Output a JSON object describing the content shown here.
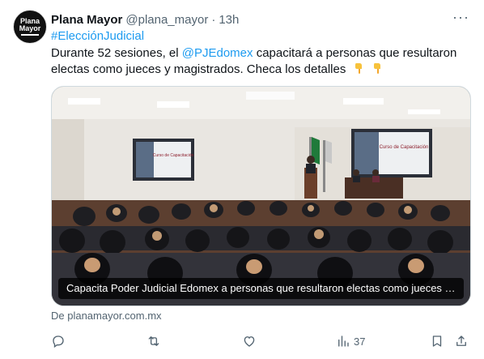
{
  "author": {
    "avatar_text_1": "Plana",
    "avatar_text_2": "Mayor",
    "name": "Plana Mayor",
    "handle": "@plana_mayor",
    "separator": "·",
    "time": "13h"
  },
  "tweet": {
    "hashtag": "#ElecciónJudicial",
    "text_before": "Durante 52 sesiones, el ",
    "mention": "@PJEdomex",
    "text_after": " capacitará a personas que resultaron electas como jueces y magistrados. Checa los detalles",
    "emoji": [
      "backhand-index-pointing-down",
      "backhand-index-pointing-down"
    ]
  },
  "media": {
    "caption": "Capacita Poder Judicial Edomex a personas que resultaron electas como jueces y magistrados",
    "screen_title": "Curso de Capacitación"
  },
  "link_source": "De planamayor.com.mx",
  "actions": {
    "reply_icon": "reply-icon",
    "retweet_icon": "retweet-icon",
    "like_icon": "heart-icon",
    "views_icon": "views-icon",
    "views_count": "37",
    "bookmark_icon": "bookmark-icon",
    "share_icon": "share-icon"
  },
  "colors": {
    "link_blue": "#1d9bf0",
    "secondary_text": "#536471",
    "primary_text": "#0f1419"
  }
}
